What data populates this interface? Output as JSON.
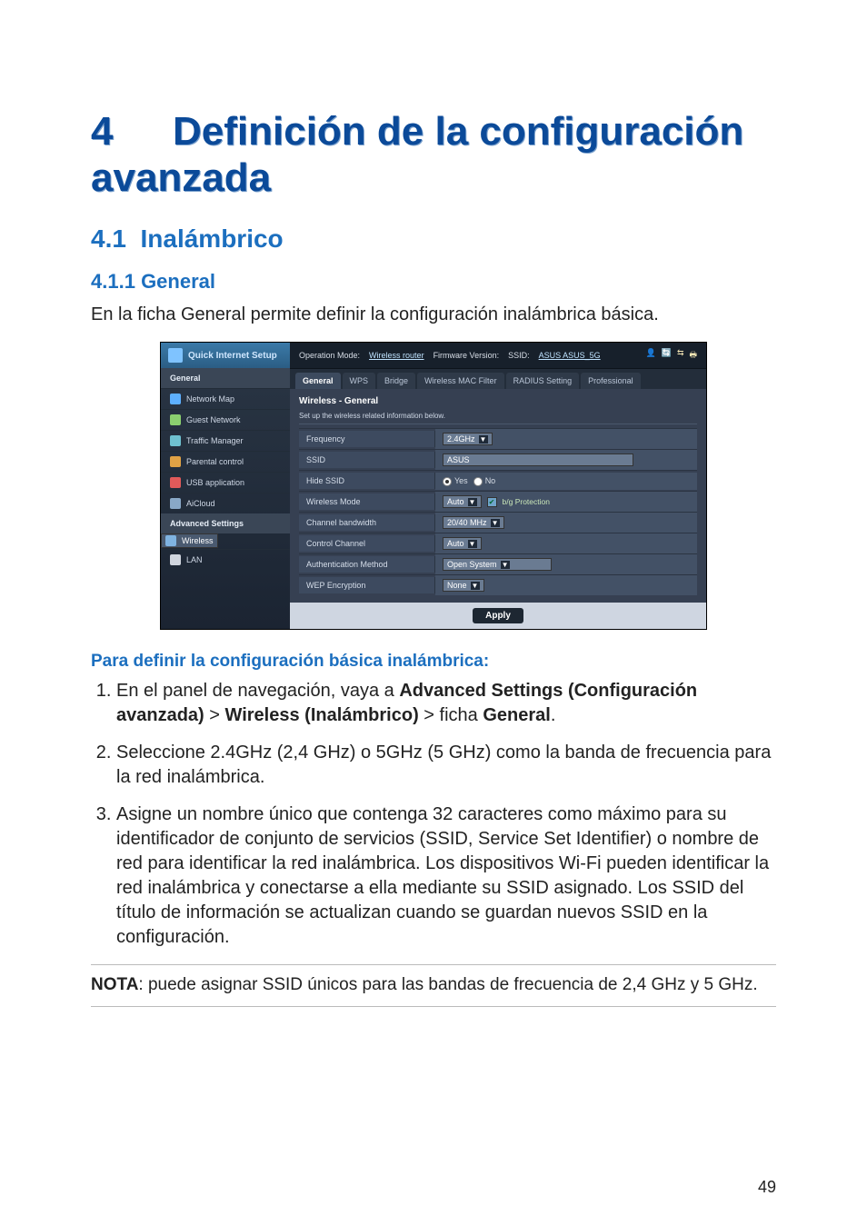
{
  "page_number": "49",
  "chapter": {
    "num": "4",
    "title": "Definición de la configuración avanzada"
  },
  "section": {
    "num": "4.1",
    "title": "Inalámbrico"
  },
  "subsection": {
    "num": "4.1.1",
    "title": "General"
  },
  "intro_text": "En la ficha General permite definir la configuración inalámbrica básica.",
  "screenshot": {
    "qis": "Quick Internet Setup",
    "side_group1_title": "General",
    "side_items1": [
      {
        "label": "Network Map",
        "color": "#5db0ff"
      },
      {
        "label": "Guest Network",
        "color": "#8bd06f"
      },
      {
        "label": "Traffic Manager",
        "color": "#6fc1d0"
      },
      {
        "label": "Parental control",
        "color": "#e0a245"
      },
      {
        "label": "USB application",
        "color": "#e05a5a"
      },
      {
        "label": "AiCloud",
        "color": "#89a8c7"
      }
    ],
    "side_group2_title": "Advanced Settings",
    "side_items2": [
      {
        "label": "Wireless",
        "selected": true,
        "color": "#7fb3e0"
      },
      {
        "label": "LAN",
        "color": "#d0d5de"
      }
    ],
    "topbar": {
      "op_label": "Operation Mode:",
      "op_value": "Wireless router",
      "fw_label": "Firmware Version:",
      "ssid_label": "SSID:",
      "ssid_value": "ASUS  ASUS_5G",
      "icons": [
        "👤",
        "🔄",
        "⇆",
        "🖶"
      ]
    },
    "tabs": [
      "General",
      "WPS",
      "Bridge",
      "Wireless MAC Filter",
      "RADIUS Setting",
      "Professional"
    ],
    "panel_title": "Wireless - General",
    "panel_sub": "Set up the wireless related information below.",
    "rows": {
      "frequency": {
        "label": "Frequency",
        "value": "2.4GHz"
      },
      "ssid": {
        "label": "SSID",
        "value": "ASUS"
      },
      "hide": {
        "label": "Hide SSID",
        "yes": "Yes",
        "no": "No"
      },
      "mode": {
        "label": "Wireless Mode",
        "value": "Auto",
        "bgp": "b/g Protection"
      },
      "bw": {
        "label": "Channel bandwidth",
        "value": "20/40 MHz"
      },
      "ch": {
        "label": "Control Channel",
        "value": "Auto"
      },
      "auth": {
        "label": "Authentication Method",
        "value": "Open System"
      },
      "wep": {
        "label": "WEP Encryption",
        "value": "None"
      }
    },
    "apply": "Apply"
  },
  "steps_head": "Para definir la configuración básica inalámbrica:",
  "steps": {
    "s1a": "En el panel de navegación, vaya a ",
    "s1b": "Advanced Settings (Configuración avanzada)",
    "s1c": " > ",
    "s1d": "Wireless (Inalámbrico)",
    "s1e": " > ficha ",
    "s1f": "General",
    "s1g": ".",
    "s2": "Seleccione 2.4GHz (2,4 GHz) o 5GHz (5 GHz) como la banda de frecuencia para la red inalámbrica.",
    "s3": "Asigne un nombre único que contenga 32 caracteres como máximo para su identificador de conjunto de servicios (SSID, Service Set Identifier) o nombre de red para identificar la red inalámbrica. Los dispositivos Wi-Fi pueden identificar la red inalámbrica y conectarse a ella mediante su SSID asignado. Los SSID del título de información se actualizan cuando se guardan nuevos SSID en la configuración."
  },
  "nota_label": "NOTA",
  "nota_text": ": puede asignar SSID únicos para las bandas de frecuencia de 2,4 GHz y 5 GHz."
}
